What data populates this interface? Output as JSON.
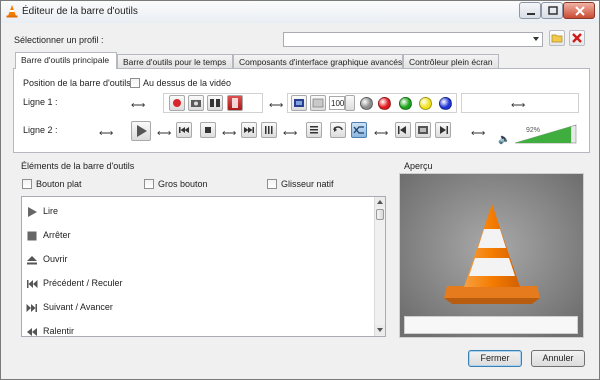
{
  "window": {
    "title": "Éditeur de la barre d'outils",
    "controls": [
      "minimize-icon",
      "maximize-icon",
      "close-icon"
    ]
  },
  "profile": {
    "label": "Sélectionner un profil :",
    "value": ""
  },
  "tabs": [
    {
      "label": "Barre d'outils principale",
      "active": true
    },
    {
      "label": "Barre d'outils pour le temps",
      "active": false
    },
    {
      "label": "Composants d'interface graphique avancés",
      "active": false
    },
    {
      "label": "Contrôleur plein écran",
      "active": false
    }
  ],
  "main_toolbar": {
    "position_label": "Position de la barre d'outils :",
    "above_video_label": "Au dessus de la vidéo",
    "above_video_checked": false,
    "line1_label": "Ligne 1 :",
    "line2_label": "Ligne 2 :",
    "speed_value": "100",
    "volume_percent": "92%",
    "volume_level": 0.92,
    "record_color": "#d9262b",
    "color_buttons": [
      "#8c8c8c",
      "#e0191d",
      "#1ca31c",
      "#f2e21b",
      "#1f33d6"
    ]
  },
  "elements": {
    "title": "Éléments de la barre d'outils",
    "flat_button_label": "Bouton plat",
    "big_button_label": "Gros bouton",
    "native_slider_label": "Glisseur natif",
    "items": [
      {
        "label": "Lire",
        "icon": "play-icon"
      },
      {
        "label": "Arrêter",
        "icon": "stop-icon"
      },
      {
        "label": "Ouvrir",
        "icon": "eject-icon"
      },
      {
        "label": "Précédent / Reculer",
        "icon": "previous-icon"
      },
      {
        "label": "Suivant / Avancer",
        "icon": "next-icon"
      },
      {
        "label": "Ralentir",
        "icon": "slower-icon"
      }
    ]
  },
  "preview": {
    "title": "Aperçu"
  },
  "buttons": {
    "close": "Fermer",
    "cancel": "Annuler"
  }
}
